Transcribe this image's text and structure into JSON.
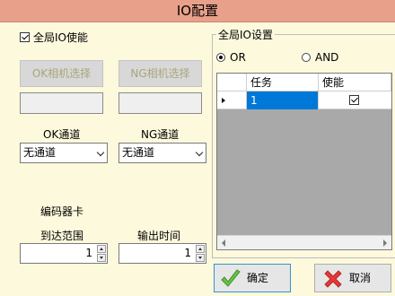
{
  "window": {
    "title": "IO配置"
  },
  "left": {
    "global_io_enable": {
      "label": "全局IO使能",
      "checked": true
    },
    "ok_camera_button": "OK相机选择",
    "ng_camera_button": "NG相机选择",
    "ok_camera_value": "",
    "ng_camera_value": "",
    "ok_channel": {
      "label": "OK通道",
      "value": "无通道"
    },
    "ng_channel": {
      "label": "NG通道",
      "value": "无通道"
    },
    "encoder_card_label": "编码器卡",
    "arrival_range": {
      "label": "到达范围",
      "value": "1"
    },
    "output_time": {
      "label": "输出时间",
      "value": "1"
    }
  },
  "global_io_settings": {
    "title": "全局IO设置",
    "mode_options": [
      {
        "label": "OR",
        "selected": true
      },
      {
        "label": "AND",
        "selected": false
      }
    ],
    "grid": {
      "columns": [
        "任务",
        "使能"
      ],
      "rows": [
        {
          "task": "1",
          "enabled": true
        }
      ]
    }
  },
  "actions": {
    "confirm": "确定",
    "cancel": "取消"
  },
  "colors": {
    "titlebar": "#e8a08a",
    "background": "#fdf9dc",
    "selection": "#0078d7",
    "confirm_icon": "#6cc04a",
    "cancel_icon": "#e53935"
  }
}
